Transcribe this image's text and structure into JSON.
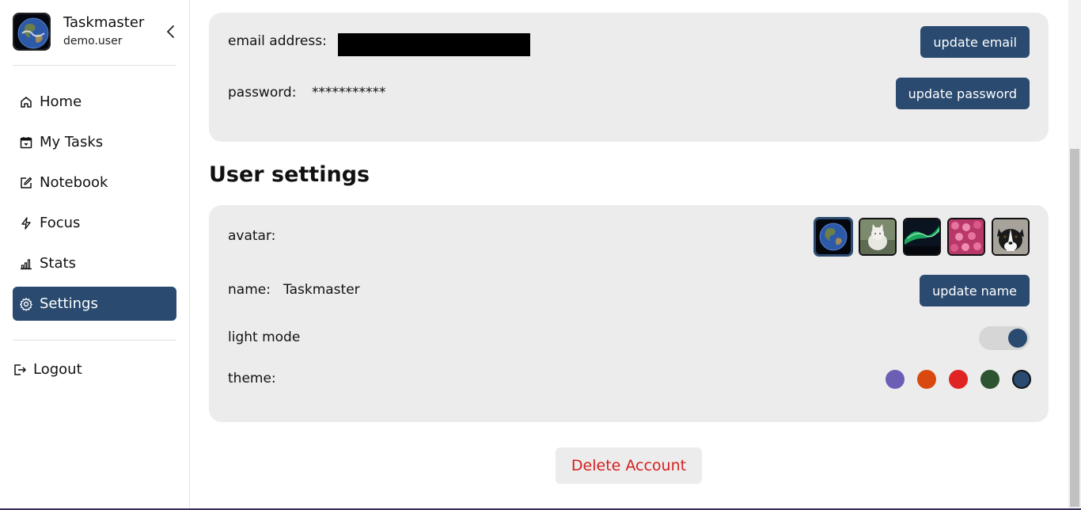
{
  "profile": {
    "name": "Taskmaster",
    "username": "demo.user",
    "avatar_icon": "earth-image"
  },
  "nav": {
    "items": [
      {
        "label": "Home",
        "icon": "home-icon"
      },
      {
        "label": "My Tasks",
        "icon": "calendar-icon"
      },
      {
        "label": "Notebook",
        "icon": "edit-icon"
      },
      {
        "label": "Focus",
        "icon": "lightning-icon"
      },
      {
        "label": "Stats",
        "icon": "bar-chart-icon"
      },
      {
        "label": "Settings",
        "icon": "gear-icon",
        "active": true
      }
    ],
    "logout_label": "Logout"
  },
  "account": {
    "email_label": "email address:",
    "update_email_label": "update email",
    "password_label": "password:",
    "password_value": "***********",
    "update_password_label": "update password"
  },
  "user_settings": {
    "title": "User settings",
    "avatar_label": "avatar:",
    "avatars": [
      "earth",
      "white-cat",
      "aurora",
      "pink-flowers",
      "dog"
    ],
    "selected_avatar": "earth",
    "name_label": "name:",
    "name_value": "Taskmaster",
    "update_name_label": "update name",
    "light_mode_label": "light mode",
    "light_mode_enabled": true,
    "theme_label": "theme:",
    "themes": [
      "#6b5fb5",
      "#d9480f",
      "#e02424",
      "#2c5430",
      "#2a4a6f"
    ],
    "selected_theme": "#2a4a6f"
  },
  "delete_account_label": "Delete Account",
  "colors": {
    "accent": "#2a4a6f",
    "danger": "#d32020",
    "card_bg": "#ececec"
  }
}
